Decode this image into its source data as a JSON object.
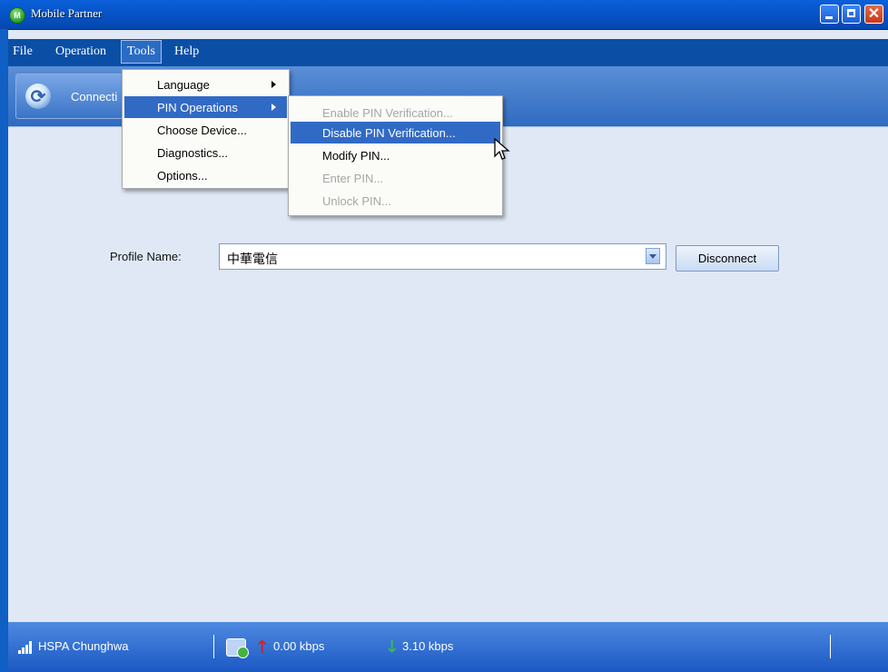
{
  "window": {
    "title": "Mobile Partner",
    "controls": {
      "minimize": "minimize",
      "maximize": "maximize",
      "close": "✕"
    }
  },
  "menubar": {
    "items": [
      {
        "label": "File"
      },
      {
        "label": "Operation"
      },
      {
        "label": "Tools"
      },
      {
        "label": "Help"
      }
    ]
  },
  "toolbar": {
    "connection_label": "Connecti"
  },
  "tools_menu": {
    "items": [
      {
        "label": "Language",
        "submenu": true
      },
      {
        "label": "PIN Operations",
        "submenu": true,
        "highlighted": true
      },
      {
        "label": "Choose Device..."
      },
      {
        "label": "Diagnostics..."
      },
      {
        "label": "Options..."
      }
    ]
  },
  "pin_submenu": {
    "items": [
      {
        "label": "Enable PIN Verification...",
        "enabled": false
      },
      {
        "label": "Disable PIN Verification...",
        "enabled": true,
        "highlighted": true
      },
      {
        "label": "Modify PIN...",
        "enabled": true
      },
      {
        "label": "Enter PIN...",
        "enabled": false
      },
      {
        "label": "Unlock PIN...",
        "enabled": false
      }
    ]
  },
  "main": {
    "profile_label": "Profile Name:",
    "profile_value": "中華電信",
    "disconnect_label": "Disconnect"
  },
  "statusbar": {
    "network": "HSPA  Chunghwa",
    "upload": "0.00 kbps",
    "download": "3.10 kbps"
  },
  "colors": {
    "titlebar": "#0650c2",
    "menubar": "#0a4fa5",
    "menu_highlight": "#316ac5",
    "content_bg": "#dfe8f4",
    "upload_arrow": "#e0191b",
    "download_arrow": "#39c13a"
  },
  "icons": {
    "app": "mobile-partner-icon",
    "connection": "refresh-icon",
    "signal": "signal-strength-icon",
    "device": "device-status-icon",
    "upload": "arrow-up-icon",
    "download": "arrow-down-icon"
  }
}
